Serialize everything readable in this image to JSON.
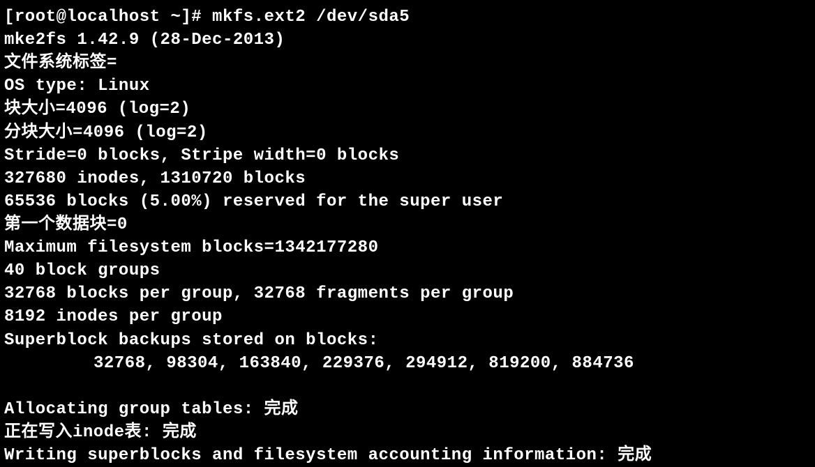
{
  "terminal": {
    "prompt": "[root@localhost ~]# ",
    "command": "mkfs.ext2 /dev/sda5",
    "lines": {
      "l1": "mke2fs 1.42.9 (28-Dec-2013)",
      "l2": "文件系统标签=",
      "l3": "OS type: Linux",
      "l4": "块大小=4096 (log=2)",
      "l5": "分块大小=4096 (log=2)",
      "l6": "Stride=0 blocks, Stripe width=0 blocks",
      "l7": "327680 inodes, 1310720 blocks",
      "l8": "65536 blocks (5.00%) reserved for the super user",
      "l9": "第一个数据块=0",
      "l10": "Maximum filesystem blocks=1342177280",
      "l11": "40 block groups",
      "l12": "32768 blocks per group, 32768 fragments per group",
      "l13": "8192 inodes per group",
      "l14": "Superblock backups stored on blocks:",
      "l15": "32768, 98304, 163840, 229376, 294912, 819200, 884736",
      "l16": "Allocating group tables: 完成",
      "l17": "正在写入inode表: 完成",
      "l18": "Writing superblocks and filesystem accounting information: 完成"
    }
  }
}
